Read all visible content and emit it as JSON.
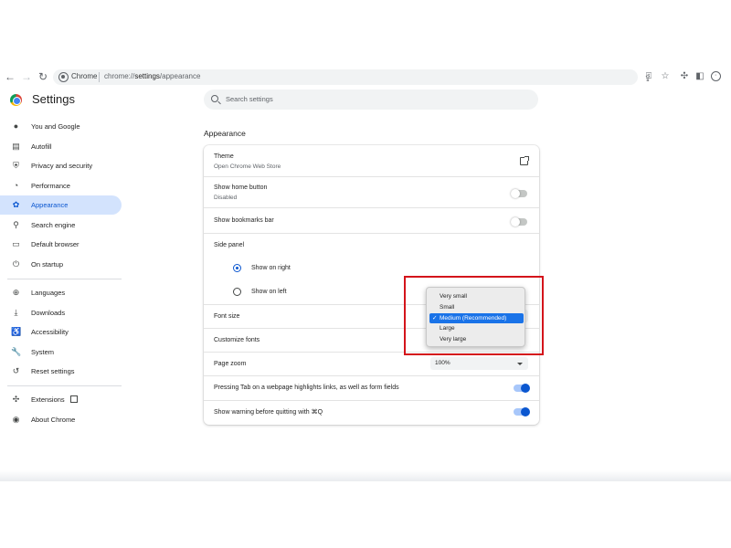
{
  "browser": {
    "tab_chip": "Chrome",
    "url_prefix": "chrome://",
    "url_host": "settings",
    "url_path": "/appearance"
  },
  "header": {
    "title": "Settings",
    "search_placeholder": "Search settings"
  },
  "sidebar": {
    "items": [
      {
        "label": "You and Google",
        "icon": "person-icon"
      },
      {
        "label": "Autofill",
        "icon": "clipboard-icon"
      },
      {
        "label": "Privacy and security",
        "icon": "shield-icon"
      },
      {
        "label": "Performance",
        "icon": "speedometer-icon"
      },
      {
        "label": "Appearance",
        "icon": "palette-icon",
        "selected": true
      },
      {
        "label": "Search engine",
        "icon": "search-icon"
      },
      {
        "label": "Default browser",
        "icon": "browser-icon"
      },
      {
        "label": "On startup",
        "icon": "power-icon"
      },
      {
        "label": "Languages",
        "icon": "globe-icon"
      },
      {
        "label": "Downloads",
        "icon": "download-icon"
      },
      {
        "label": "Accessibility",
        "icon": "accessibility-icon"
      },
      {
        "label": "System",
        "icon": "wrench-icon"
      },
      {
        "label": "Reset settings",
        "icon": "history-icon"
      },
      {
        "label": "Extensions",
        "icon": "puzzle-icon"
      },
      {
        "label": "About Chrome",
        "icon": "chrome-icon"
      }
    ]
  },
  "appearance": {
    "section_title": "Appearance",
    "theme_label": "Theme",
    "theme_sub": "Open Chrome Web Store",
    "home_button_label": "Show home button",
    "home_button_sub": "Disabled",
    "home_button_on": false,
    "bookmarks_bar_label": "Show bookmarks bar",
    "bookmarks_bar_on": false,
    "side_panel_label": "Side panel",
    "side_panel_right": "Show on right",
    "side_panel_left": "Show on left",
    "side_panel_selected": "Show on right",
    "font_size_label": "Font size",
    "customize_fonts_label": "Customize fonts",
    "page_zoom_label": "Page zoom",
    "page_zoom_value": "100%",
    "tab_highlight_label": "Pressing Tab on a webpage highlights links, as well as form fields",
    "tab_highlight_on": true,
    "quit_warning_label": "Show warning before quitting with ⌘Q",
    "quit_warning_on": true
  },
  "font_dropdown": {
    "options": [
      "Very small",
      "Small",
      "Medium (Recommended)",
      "Large",
      "Very large"
    ],
    "selected": "Medium (Recommended)",
    "check_mark": "✓"
  },
  "colors": {
    "accent": "#0b57d0",
    "selected_nav_bg": "#d3e3fd",
    "highlight_box": "#d4141b",
    "dropdown_selected": "#1a73e8"
  }
}
